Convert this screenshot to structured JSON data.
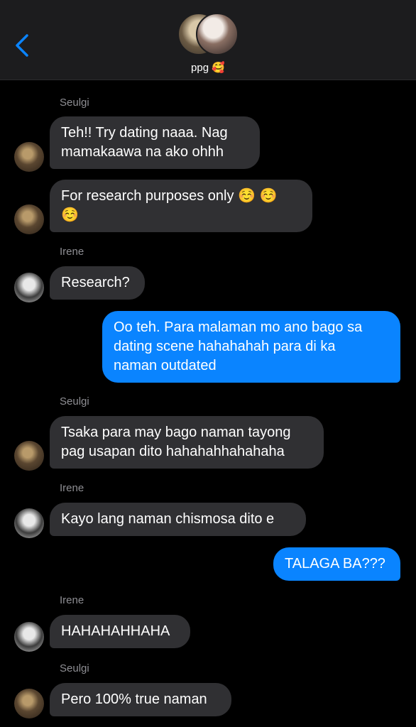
{
  "header": {
    "group_name": "ppg",
    "group_emoji": "🥰",
    "back_icon": "chevron-left-icon",
    "accent_color": "#0a84ff"
  },
  "messages": [
    {
      "sender": "Seulgi",
      "text": "Teh!! Try dating naaa. Nag\nmamakaawa na ako ohhh"
    },
    {
      "text": "For research purposes only ☺️ ☺️\n☺️"
    },
    {
      "sender": "Irene",
      "text": "Research?"
    },
    {
      "outgoing": true,
      "text": "Oo teh. Para malaman mo ano bago sa\ndating scene hahahahah para di ka\nnaman outdated"
    },
    {
      "sender": "Seulgi",
      "text": "Tsaka para may bago naman tayong\npag usapan dito hahahahhahahaha"
    },
    {
      "sender": "Irene",
      "text": "Kayo lang naman chismosa dito e"
    },
    {
      "outgoing": true,
      "text": "TALAGA BA???"
    },
    {
      "sender": "Irene",
      "text": "HAHAHAHHAHA"
    },
    {
      "sender": "Seulgi",
      "text": "Pero 100% true naman"
    }
  ],
  "colors": {
    "incoming_bubble": "#303033",
    "outgoing_bubble": "#0a84ff",
    "background": "#000000",
    "header_bg": "#1c1c1e",
    "sender_label": "#8e8e93"
  }
}
